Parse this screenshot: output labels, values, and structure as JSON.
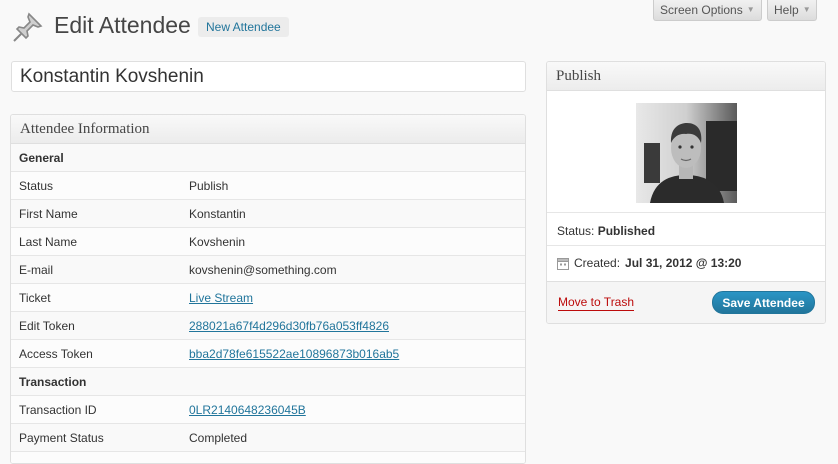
{
  "screen_meta": {
    "screen_options_label": "Screen Options",
    "help_label": "Help"
  },
  "header": {
    "title": "Edit Attendee",
    "add_new_label": "New Attendee"
  },
  "title_field": {
    "value": "Konstantin Kovshenin"
  },
  "attendee_info": {
    "heading": "Attendee Information",
    "rows": [
      {
        "type": "section",
        "label": "General"
      },
      {
        "type": "field",
        "label": "Status",
        "value": "Publish"
      },
      {
        "type": "field",
        "label": "First Name",
        "value": "Konstantin"
      },
      {
        "type": "field",
        "label": "Last Name",
        "value": "Kovshenin"
      },
      {
        "type": "field",
        "label": "E-mail",
        "value": "kovshenin@something.com"
      },
      {
        "type": "link",
        "label": "Ticket",
        "value": "Live Stream"
      },
      {
        "type": "link",
        "label": "Edit Token",
        "value": "288021a67f4d296d30fb76a053ff4826"
      },
      {
        "type": "link",
        "label": "Access Token",
        "value": "bba2d78fe615522ae10896873b016ab5"
      },
      {
        "type": "section",
        "label": "Transaction"
      },
      {
        "type": "link",
        "label": "Transaction ID",
        "value": "0LR2140648236045B"
      },
      {
        "type": "field",
        "label": "Payment Status",
        "value": "Completed"
      },
      {
        "type": "field",
        "label": "",
        "value": ""
      }
    ]
  },
  "publish": {
    "heading": "Publish",
    "status_label": "Status:",
    "status_value": "Published",
    "created_label": "Created:",
    "created_value": "Jul 31, 2012 @ 13:20",
    "trash_label": "Move to Trash",
    "save_label": "Save Attendee"
  },
  "colors": {
    "link": "#21759b",
    "trash": "#bc0b0b",
    "primary_button": "#21759b"
  },
  "icons": [
    "pushpin-icon",
    "calendar-icon",
    "caret-down-icon"
  ]
}
